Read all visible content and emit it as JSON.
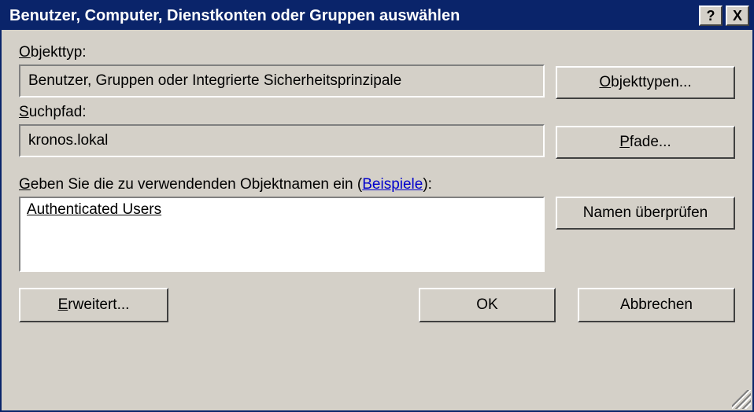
{
  "title": "Benutzer, Computer, Dienstkonten oder Gruppen auswählen",
  "labels": {
    "objekttyp": "Objekttyp:",
    "objekttyp_accel": "O",
    "suchpfad": "uchpfad:",
    "suchpfad_accel": "S",
    "geben": "eben Sie die zu verwendenden Objektnamen ein (",
    "geben_accel": "G",
    "beispiele": "Beispiele",
    "geben_after": "):"
  },
  "fields": {
    "objekttyp_value": "Benutzer, Gruppen oder Integrierte Sicherheitsprinzipale",
    "suchpfad_value": "kronos.lokal",
    "names_value": "Authenticated Users"
  },
  "buttons": {
    "objekttypen": "bjekttypen...",
    "objekttypen_accel": "O",
    "pfade": "fade...",
    "pfade_accel": "P",
    "namen_pruefen": "Namen überprüfen",
    "erweitert": "rweitert...",
    "erweitert_accel": "E",
    "ok": "OK",
    "abbrechen": "Abbrechen",
    "help": "?",
    "close": "X"
  }
}
